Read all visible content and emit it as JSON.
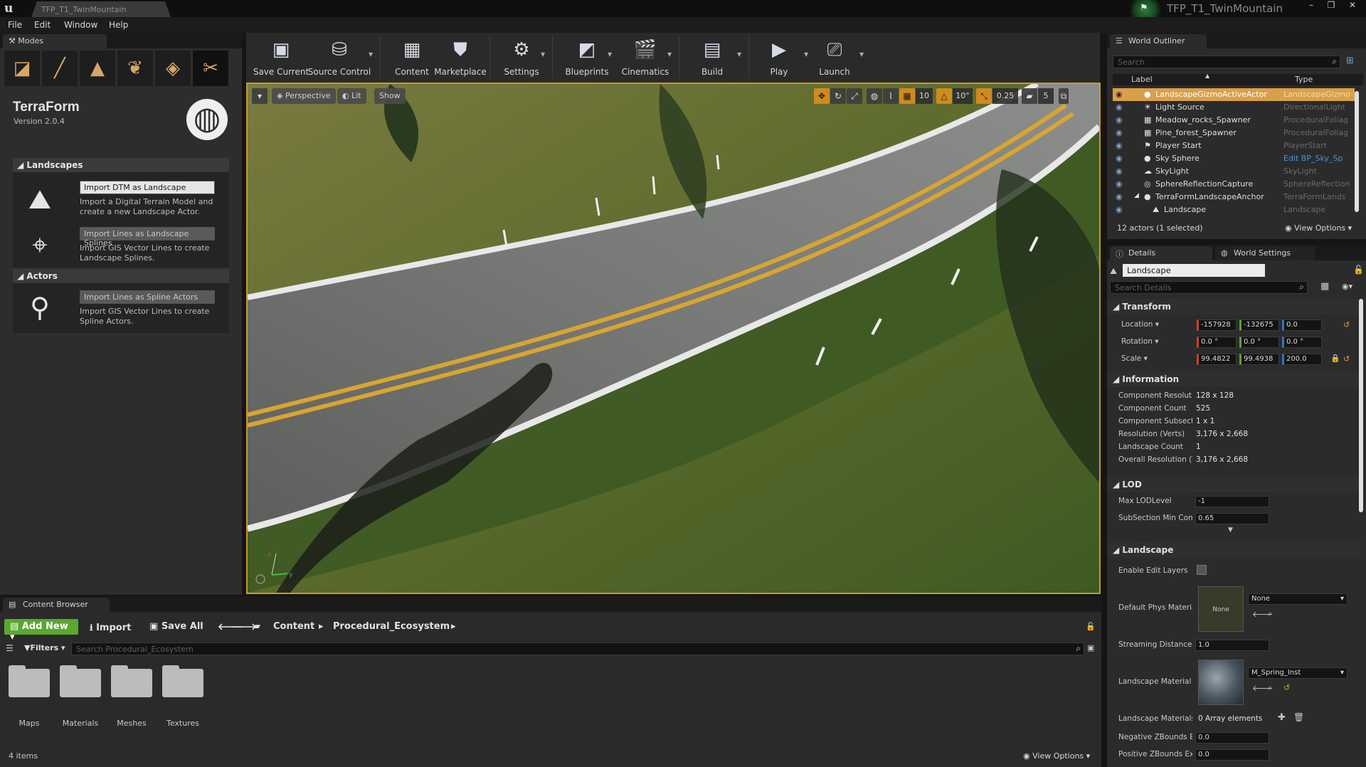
{
  "window": {
    "tab_title": "TFP_T1_TwinMountain",
    "project_name": "TFP_T1_TwinMountain",
    "minimize": "–",
    "maximize": "❐",
    "close": "✕"
  },
  "menu": [
    "File",
    "Edit",
    "Window",
    "Help"
  ],
  "modes": {
    "tab_label": "Modes",
    "plugin_name": "TerraForm",
    "plugin_version": "Version 2.0.4",
    "sections": {
      "landscapes": "Landscapes",
      "actors": "Actors"
    },
    "importers": [
      {
        "button": "Import DTM as Landscape",
        "desc": "Import a Digital Terrain Model and create a new Landscape Actor.",
        "enabled": true
      },
      {
        "button": "Import Lines as Landscape Splines",
        "desc": "Import GIS Vector Lines to create Landscape Splines.",
        "enabled": false
      },
      {
        "button": "Import Lines as Spline Actors",
        "desc": "Import GIS Vector Lines to create Spline Actors.",
        "enabled": false
      }
    ]
  },
  "toolbar": {
    "buttons": [
      {
        "label": "Save Current",
        "icon": "save-icon"
      },
      {
        "label": "Source Control",
        "icon": "source-control-icon"
      },
      {
        "label": "Content",
        "icon": "content-icon"
      },
      {
        "label": "Marketplace",
        "icon": "marketplace-icon"
      },
      {
        "label": "Settings",
        "icon": "settings-icon"
      },
      {
        "label": "Blueprints",
        "icon": "blueprints-icon"
      },
      {
        "label": "Cinematics",
        "icon": "cinematics-icon"
      },
      {
        "label": "Build",
        "icon": "build-icon"
      },
      {
        "label": "Play",
        "icon": "play-icon"
      },
      {
        "label": "Launch",
        "icon": "launch-icon"
      }
    ]
  },
  "viewport": {
    "perspective": "Perspective",
    "lit": "Lit",
    "show": "Show",
    "grid_snap": "10",
    "rotation_snap": "10°",
    "scale_snap": "0.25",
    "camera_speed": "5",
    "axis_x": "x",
    "axis_y": "y"
  },
  "outliner": {
    "tab_label": "World Outliner",
    "search_placeholder": "Search",
    "col_label": "Label",
    "col_type": "Type",
    "rows": [
      {
        "label": "LandscapeGizmoActiveActor",
        "type": "LandscapeGizmo",
        "selected": true
      },
      {
        "label": "Light Source",
        "type": "DirectionalLight"
      },
      {
        "label": "Meadow_rocks_Spawner",
        "type": "ProceduralFoliag"
      },
      {
        "label": "Pine_forest_Spawner",
        "type": "ProceduralFoliag"
      },
      {
        "label": "Player Start",
        "type": "PlayerStart"
      },
      {
        "label": "Sky Sphere",
        "type": "Edit BP_Sky_Sp",
        "link": true
      },
      {
        "label": "SkyLight",
        "type": "SkyLight"
      },
      {
        "label": "SphereReflectionCapture",
        "type": "SphereReflection"
      },
      {
        "label": "TerraFormLandscapeAnchor",
        "type": "TerraFormLands"
      },
      {
        "label": "Landscape",
        "type": "Landscape",
        "child": true
      }
    ],
    "count": "12 actors (1 selected)",
    "view_options": "View Options"
  },
  "details": {
    "tab_details": "Details",
    "tab_world_settings": "World Settings",
    "object_name": "Landscape",
    "search_placeholder": "Search Details",
    "transform": {
      "title": "Transform",
      "location_label": "Location",
      "rotation_label": "Rotation",
      "scale_label": "Scale",
      "location": [
        "-157928",
        "-132675",
        "0.0"
      ],
      "rotation": [
        "0.0 °",
        "0.0 °",
        "0.0 °"
      ],
      "scale": [
        "99.4822",
        "99.4938",
        "200.0"
      ]
    },
    "information": {
      "title": "Information",
      "rows": [
        {
          "label": "Component Resolution",
          "value": "128 x 128"
        },
        {
          "label": "Component Count",
          "value": "525"
        },
        {
          "label": "Component Subsections",
          "value": "1 x 1"
        },
        {
          "label": "Resolution (Verts)",
          "value": "3,176 x 2,668"
        },
        {
          "label": "Landscape Count",
          "value": "1"
        },
        {
          "label": "Overall Resolution (Verts)",
          "value": "3,176 x 2,668"
        }
      ]
    },
    "lod": {
      "title": "LOD",
      "max_lod_label": "Max LODLevel",
      "max_lod": "-1",
      "subsection_label": "SubSection Min Component Screen Size",
      "subsection": "0.65"
    },
    "landscape": {
      "title": "Landscape",
      "enable_edit_layers": "Enable Edit Layers",
      "phys_material_label": "Default Phys Material",
      "phys_thumb": "None",
      "phys_value": "None",
      "streaming_label": "Streaming Distance Multiplier",
      "streaming": "1.0",
      "material_label": "Landscape Material",
      "material_value": "M_Spring_Inst",
      "materials_override_label": "Landscape Materials Override",
      "materials_override": "0 Array elements",
      "neg_zbounds_label": "Negative ZBounds Extension",
      "neg_zbounds": "0.0",
      "pos_zbounds_label": "Positive ZBounds Extension",
      "pos_zbounds": "0.0"
    }
  },
  "content_browser": {
    "tab_label": "Content Browser",
    "add_new": "Add New",
    "import": "Import",
    "save_all": "Save All",
    "path": [
      "Content",
      "Procedural_Ecosystem"
    ],
    "filters": "Filters",
    "search_placeholder": "Search Procedural_Ecosystem",
    "folders": [
      "Maps",
      "Materials",
      "Meshes",
      "Textures"
    ],
    "count": "4 items",
    "view_options": "View Options"
  },
  "colors": {
    "accent_orange": "#c99a2a",
    "add_new_green": "#5aa82e",
    "selected_row": "#d9a04a"
  }
}
